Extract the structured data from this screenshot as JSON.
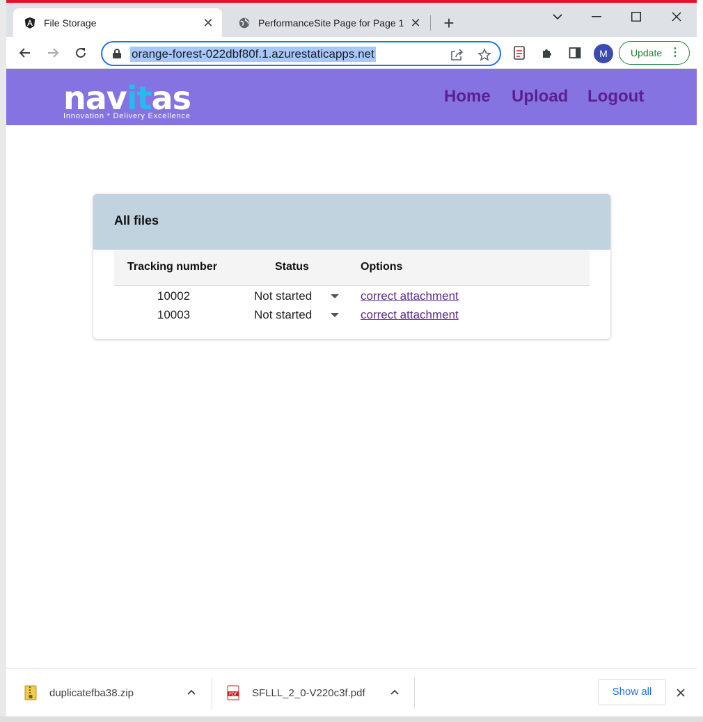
{
  "browser": {
    "tabs": [
      {
        "title": "File Storage",
        "favicon": "angular-icon",
        "active": true
      },
      {
        "title": "PerformanceSite Page for Page 1",
        "favicon": "globe-icon",
        "active": false
      }
    ],
    "url": "orange-forest-022dbf80f.1.azurestaticapps.net",
    "profile_initial": "M",
    "update_label": "Update",
    "colors": {
      "accent": "#1a73e8",
      "update": "#188038"
    }
  },
  "site": {
    "logo": {
      "word_start": "nav",
      "word_accent": "it",
      "word_end": "as",
      "tagline": "Innovation * Delivery Excellence"
    },
    "nav": [
      {
        "label": "Home"
      },
      {
        "label": "Upload"
      },
      {
        "label": "Logout"
      }
    ],
    "colors": {
      "header_bg": "#8673e2",
      "nav_text": "#5b1f8f",
      "card_header_bg": "#c1d3df"
    }
  },
  "files_card": {
    "title": "All files",
    "columns": [
      "Tracking number",
      "Status",
      "Options"
    ],
    "rows": [
      {
        "tracking_number": "10002",
        "status": "Not started",
        "option": "correct attachment"
      },
      {
        "tracking_number": "10003",
        "status": "Not started",
        "option": "correct attachment"
      }
    ]
  },
  "downloads": {
    "items": [
      {
        "name": "duplicatefba38.zip",
        "icon": "zip-file-icon"
      },
      {
        "name": "SFLLL_2_0-V220c3f.pdf",
        "icon": "pdf-file-icon"
      }
    ],
    "show_all_label": "Show all"
  }
}
